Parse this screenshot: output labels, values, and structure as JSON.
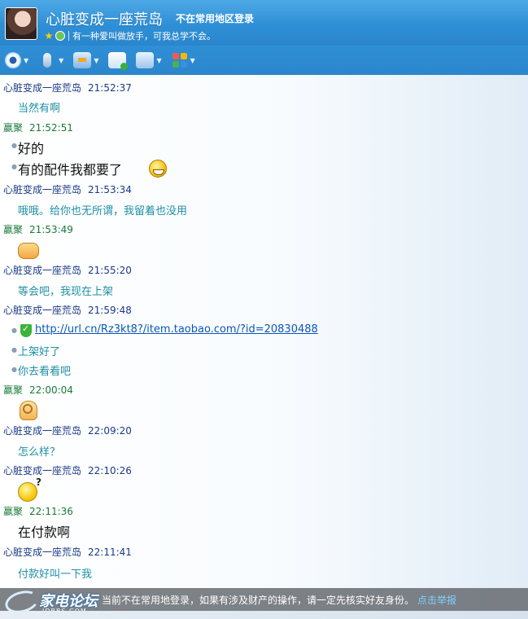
{
  "header": {
    "contact_name": "心脏变成一座荒岛",
    "login_warning": "不在常用地区登录",
    "signature": "有一种爱叫做放手，可我总学不会。"
  },
  "toolbar": {
    "buttons": [
      {
        "icon": "video-camera-icon"
      },
      {
        "icon": "microphone-icon"
      },
      {
        "icon": "file-transfer-icon"
      },
      {
        "icon": "new-message-icon"
      },
      {
        "icon": "screen-share-icon"
      },
      {
        "icon": "apps-icon"
      }
    ]
  },
  "messages": [
    {
      "sender": "心脏变成一座荒岛",
      "time": "21:52:37",
      "lines": [
        "当然有啊"
      ]
    },
    {
      "sender": "赢聚",
      "time": "21:52:51",
      "lines": [
        "好的",
        "有的配件我都要了"
      ]
    },
    {
      "sender": "心脏变成一座荒岛",
      "time": "21:53:34",
      "lines": [
        "哦哦。给你也无所谓，我留着也没用"
      ]
    },
    {
      "sender": "赢聚",
      "time": "21:53:49",
      "emoji": "handshake-emoji"
    },
    {
      "sender": "心脏变成一座荒岛",
      "time": "21:55:20",
      "lines": [
        "等会吧，我现在上架"
      ]
    },
    {
      "sender": "心脏变成一座荒岛",
      "time": "21:59:48",
      "link": "http://url.cn/Rz3kt8?/item.taobao.com/?id=20830488",
      "lines": [
        "上架好了",
        "你去看看吧"
      ]
    },
    {
      "sender": "赢聚",
      "time": "22:00:04",
      "emoji": "ok-hand-emoji"
    },
    {
      "sender": "心脏变成一座荒岛",
      "time": "22:09:20",
      "lines": [
        "怎么样？"
      ]
    },
    {
      "sender": "心脏变成一座荒岛",
      "time": "22:10:26",
      "emoji": "thinking-emoji"
    },
    {
      "sender": "赢聚",
      "time": "22:11:36",
      "lines": [
        "在付款啊"
      ]
    },
    {
      "sender": "心脏变成一座荒岛",
      "time": "22:11:41",
      "lines": [
        "付款好叫一下我"
      ]
    }
  ],
  "footer": {
    "notice": "当前不在常用地登录，如果有涉及财产的操作，请一定先核实好友身份。",
    "report_link": "点击举报"
  },
  "watermark": {
    "title": "家电论坛",
    "subtitle": "JDBBS.COM"
  },
  "colors": {
    "title_bar": "#2f8fd6",
    "other_sender": "#1a3a87",
    "self_sender": "#1a7a3a",
    "message_text": "#1e8fa4",
    "link": "#0b57b5"
  }
}
